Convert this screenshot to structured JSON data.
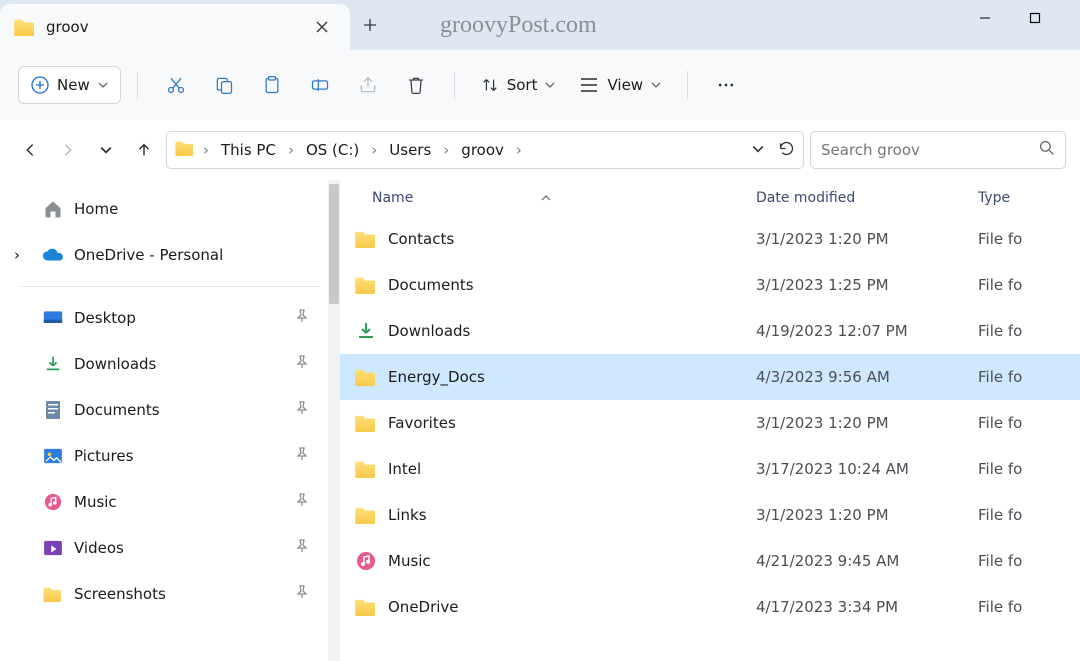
{
  "tab": {
    "title": "groov"
  },
  "watermark": "groovyPost.com",
  "toolbar": {
    "new_label": "New",
    "sort_label": "Sort",
    "view_label": "View"
  },
  "breadcrumbs": [
    "This PC",
    "OS (C:)",
    "Users",
    "groov"
  ],
  "search": {
    "placeholder": "Search groov"
  },
  "sidebar": {
    "home": "Home",
    "onedrive": "OneDrive - Personal",
    "quick": [
      "Desktop",
      "Downloads",
      "Documents",
      "Pictures",
      "Music",
      "Videos",
      "Screenshots"
    ]
  },
  "columns": {
    "name": "Name",
    "date": "Date modified",
    "type": "Type"
  },
  "rows": [
    {
      "name": "Contacts",
      "date": "3/1/2023 1:20 PM",
      "type": "File fo",
      "icon": "folder",
      "selected": false
    },
    {
      "name": "Documents",
      "date": "3/1/2023 1:25 PM",
      "type": "File fo",
      "icon": "folder",
      "selected": false
    },
    {
      "name": "Downloads",
      "date": "4/19/2023 12:07 PM",
      "type": "File fo",
      "icon": "download",
      "selected": false
    },
    {
      "name": "Energy_Docs",
      "date": "4/3/2023 9:56 AM",
      "type": "File fo",
      "icon": "folder",
      "selected": true
    },
    {
      "name": "Favorites",
      "date": "3/1/2023 1:20 PM",
      "type": "File fo",
      "icon": "folder",
      "selected": false
    },
    {
      "name": "Intel",
      "date": "3/17/2023 10:24 AM",
      "type": "File fo",
      "icon": "folder",
      "selected": false
    },
    {
      "name": "Links",
      "date": "3/1/2023 1:20 PM",
      "type": "File fo",
      "icon": "folder",
      "selected": false
    },
    {
      "name": "Music",
      "date": "4/21/2023 9:45 AM",
      "type": "File fo",
      "icon": "music",
      "selected": false
    },
    {
      "name": "OneDrive",
      "date": "4/17/2023 3:34 PM",
      "type": "File fo",
      "icon": "folder",
      "selected": false
    }
  ]
}
